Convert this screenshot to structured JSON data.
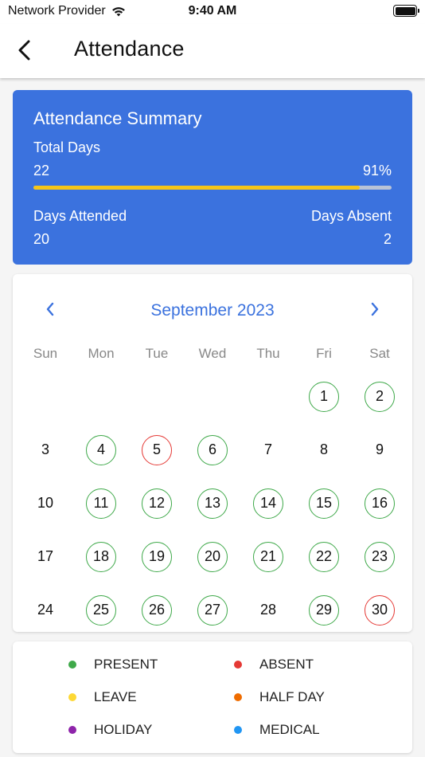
{
  "status_bar": {
    "carrier": "Network Provider",
    "time": "9:40 AM"
  },
  "app_bar": {
    "title": "Attendance",
    "back_icon": "chevron-left-icon"
  },
  "summary": {
    "title": "Attendance Summary",
    "total_days_label": "Total Days",
    "total_days_value": "22",
    "percent_label": "91%",
    "progress_fraction": 0.91,
    "days_attended_label": "Days Attended",
    "days_attended_value": "20",
    "days_absent_label": "Days Absent",
    "days_absent_value": "2"
  },
  "calendar": {
    "month_label": "September 2023",
    "prev_icon": "chevron-left-icon",
    "next_icon": "chevron-right-icon",
    "weekdays": [
      "Sun",
      "Mon",
      "Tue",
      "Wed",
      "Thu",
      "Fri",
      "Sat"
    ],
    "weeks": [
      [
        null,
        null,
        null,
        null,
        null,
        {
          "d": "1",
          "s": "present"
        },
        {
          "d": "2",
          "s": "present"
        }
      ],
      [
        {
          "d": "3",
          "s": ""
        },
        {
          "d": "4",
          "s": "present"
        },
        {
          "d": "5",
          "s": "absent"
        },
        {
          "d": "6",
          "s": "present"
        },
        {
          "d": "7",
          "s": ""
        },
        {
          "d": "8",
          "s": ""
        },
        {
          "d": "9",
          "s": ""
        }
      ],
      [
        {
          "d": "10",
          "s": ""
        },
        {
          "d": "11",
          "s": "present"
        },
        {
          "d": "12",
          "s": "present"
        },
        {
          "d": "13",
          "s": "present"
        },
        {
          "d": "14",
          "s": "present"
        },
        {
          "d": "15",
          "s": "present"
        },
        {
          "d": "16",
          "s": "present"
        }
      ],
      [
        {
          "d": "17",
          "s": ""
        },
        {
          "d": "18",
          "s": "present"
        },
        {
          "d": "19",
          "s": "present"
        },
        {
          "d": "20",
          "s": "present"
        },
        {
          "d": "21",
          "s": "present"
        },
        {
          "d": "22",
          "s": "present"
        },
        {
          "d": "23",
          "s": "present"
        }
      ],
      [
        {
          "d": "24",
          "s": ""
        },
        {
          "d": "25",
          "s": "present"
        },
        {
          "d": "26",
          "s": "present"
        },
        {
          "d": "27",
          "s": "present"
        },
        {
          "d": "28",
          "s": ""
        },
        {
          "d": "29",
          "s": "present"
        },
        {
          "d": "30",
          "s": "absent"
        }
      ]
    ]
  },
  "legend": {
    "items": [
      {
        "label": "PRESENT",
        "color": "#3fa94a"
      },
      {
        "label": "ABSENT",
        "color": "#e53935"
      },
      {
        "label": "LEAVE",
        "color": "#fdd835"
      },
      {
        "label": "HALF DAY",
        "color": "#ef6c00"
      },
      {
        "label": "HOLIDAY",
        "color": "#8e24aa"
      },
      {
        "label": "MEDICAL",
        "color": "#2196f3"
      }
    ]
  },
  "colors": {
    "accent": "#3b72de",
    "present": "#3fa94a",
    "absent": "#e53935",
    "progress": "#f5c518"
  }
}
